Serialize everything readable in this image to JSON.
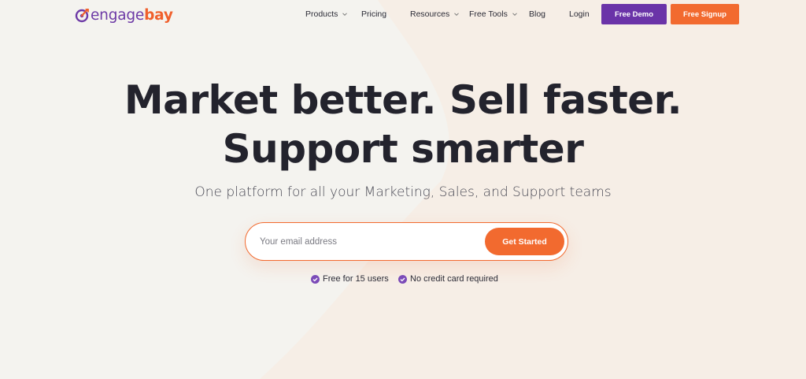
{
  "brand": {
    "name_part1": "engage",
    "name_part2": "bay",
    "logo_icon": "engagebay-target-icon",
    "colors": {
      "purple": "#6a33a8",
      "orange": "#f26a2f",
      "text": "#23232d"
    }
  },
  "nav": {
    "items": [
      {
        "label": "Products",
        "has_dropdown": true
      },
      {
        "label": "Pricing",
        "has_dropdown": false
      },
      {
        "label": "Resources",
        "has_dropdown": true
      },
      {
        "label": "Free Tools",
        "has_dropdown": true
      },
      {
        "label": "Blog",
        "has_dropdown": false
      },
      {
        "label": "Login",
        "has_dropdown": false
      }
    ],
    "demo_label": "Free Demo",
    "signup_label": "Free Signup"
  },
  "hero": {
    "title_line1": "Market better. Sell faster.",
    "title_line2": "Support smarter",
    "subtitle": "One platform for all your Marketing, Sales, and Support teams",
    "email_placeholder": "Your email address",
    "cta_label": "Get Started",
    "perks": [
      "Free for 15 users",
      "No credit card required"
    ]
  }
}
